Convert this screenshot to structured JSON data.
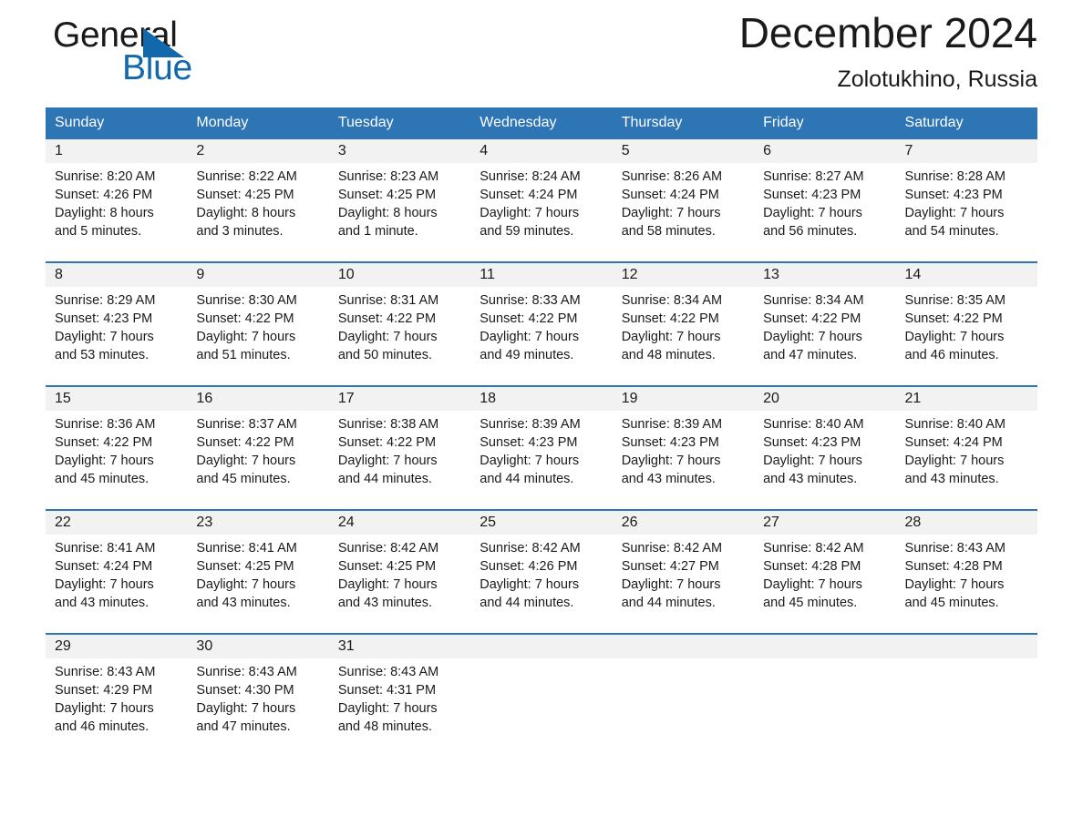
{
  "brand": {
    "word1": "General",
    "word2": "Blue",
    "triangle_color": "#1268ad"
  },
  "header": {
    "month_title": "December 2024",
    "location": "Zolotukhino, Russia",
    "accent_color": "#2e75b6",
    "daynum_band_color": "#f2f2f2"
  },
  "weekday_headers": [
    "Sunday",
    "Monday",
    "Tuesday",
    "Wednesday",
    "Thursday",
    "Friday",
    "Saturday"
  ],
  "labels": {
    "sunrise_prefix": "Sunrise:",
    "sunset_prefix": "Sunset:",
    "daylight_prefix": "Daylight:"
  },
  "weeks": [
    [
      {
        "day": "1",
        "sunrise": "Sunrise: 8:20 AM",
        "sunset": "Sunset: 4:26 PM",
        "daylight_line1": "Daylight: 8 hours",
        "daylight_line2": "and 5 minutes."
      },
      {
        "day": "2",
        "sunrise": "Sunrise: 8:22 AM",
        "sunset": "Sunset: 4:25 PM",
        "daylight_line1": "Daylight: 8 hours",
        "daylight_line2": "and 3 minutes."
      },
      {
        "day": "3",
        "sunrise": "Sunrise: 8:23 AM",
        "sunset": "Sunset: 4:25 PM",
        "daylight_line1": "Daylight: 8 hours",
        "daylight_line2": "and 1 minute."
      },
      {
        "day": "4",
        "sunrise": "Sunrise: 8:24 AM",
        "sunset": "Sunset: 4:24 PM",
        "daylight_line1": "Daylight: 7 hours",
        "daylight_line2": "and 59 minutes."
      },
      {
        "day": "5",
        "sunrise": "Sunrise: 8:26 AM",
        "sunset": "Sunset: 4:24 PM",
        "daylight_line1": "Daylight: 7 hours",
        "daylight_line2": "and 58 minutes."
      },
      {
        "day": "6",
        "sunrise": "Sunrise: 8:27 AM",
        "sunset": "Sunset: 4:23 PM",
        "daylight_line1": "Daylight: 7 hours",
        "daylight_line2": "and 56 minutes."
      },
      {
        "day": "7",
        "sunrise": "Sunrise: 8:28 AM",
        "sunset": "Sunset: 4:23 PM",
        "daylight_line1": "Daylight: 7 hours",
        "daylight_line2": "and 54 minutes."
      }
    ],
    [
      {
        "day": "8",
        "sunrise": "Sunrise: 8:29 AM",
        "sunset": "Sunset: 4:23 PM",
        "daylight_line1": "Daylight: 7 hours",
        "daylight_line2": "and 53 minutes."
      },
      {
        "day": "9",
        "sunrise": "Sunrise: 8:30 AM",
        "sunset": "Sunset: 4:22 PM",
        "daylight_line1": "Daylight: 7 hours",
        "daylight_line2": "and 51 minutes."
      },
      {
        "day": "10",
        "sunrise": "Sunrise: 8:31 AM",
        "sunset": "Sunset: 4:22 PM",
        "daylight_line1": "Daylight: 7 hours",
        "daylight_line2": "and 50 minutes."
      },
      {
        "day": "11",
        "sunrise": "Sunrise: 8:33 AM",
        "sunset": "Sunset: 4:22 PM",
        "daylight_line1": "Daylight: 7 hours",
        "daylight_line2": "and 49 minutes."
      },
      {
        "day": "12",
        "sunrise": "Sunrise: 8:34 AM",
        "sunset": "Sunset: 4:22 PM",
        "daylight_line1": "Daylight: 7 hours",
        "daylight_line2": "and 48 minutes."
      },
      {
        "day": "13",
        "sunrise": "Sunrise: 8:34 AM",
        "sunset": "Sunset: 4:22 PM",
        "daylight_line1": "Daylight: 7 hours",
        "daylight_line2": "and 47 minutes."
      },
      {
        "day": "14",
        "sunrise": "Sunrise: 8:35 AM",
        "sunset": "Sunset: 4:22 PM",
        "daylight_line1": "Daylight: 7 hours",
        "daylight_line2": "and 46 minutes."
      }
    ],
    [
      {
        "day": "15",
        "sunrise": "Sunrise: 8:36 AM",
        "sunset": "Sunset: 4:22 PM",
        "daylight_line1": "Daylight: 7 hours",
        "daylight_line2": "and 45 minutes."
      },
      {
        "day": "16",
        "sunrise": "Sunrise: 8:37 AM",
        "sunset": "Sunset: 4:22 PM",
        "daylight_line1": "Daylight: 7 hours",
        "daylight_line2": "and 45 minutes."
      },
      {
        "day": "17",
        "sunrise": "Sunrise: 8:38 AM",
        "sunset": "Sunset: 4:22 PM",
        "daylight_line1": "Daylight: 7 hours",
        "daylight_line2": "and 44 minutes."
      },
      {
        "day": "18",
        "sunrise": "Sunrise: 8:39 AM",
        "sunset": "Sunset: 4:23 PM",
        "daylight_line1": "Daylight: 7 hours",
        "daylight_line2": "and 44 minutes."
      },
      {
        "day": "19",
        "sunrise": "Sunrise: 8:39 AM",
        "sunset": "Sunset: 4:23 PM",
        "daylight_line1": "Daylight: 7 hours",
        "daylight_line2": "and 43 minutes."
      },
      {
        "day": "20",
        "sunrise": "Sunrise: 8:40 AM",
        "sunset": "Sunset: 4:23 PM",
        "daylight_line1": "Daylight: 7 hours",
        "daylight_line2": "and 43 minutes."
      },
      {
        "day": "21",
        "sunrise": "Sunrise: 8:40 AM",
        "sunset": "Sunset: 4:24 PM",
        "daylight_line1": "Daylight: 7 hours",
        "daylight_line2": "and 43 minutes."
      }
    ],
    [
      {
        "day": "22",
        "sunrise": "Sunrise: 8:41 AM",
        "sunset": "Sunset: 4:24 PM",
        "daylight_line1": "Daylight: 7 hours",
        "daylight_line2": "and 43 minutes."
      },
      {
        "day": "23",
        "sunrise": "Sunrise: 8:41 AM",
        "sunset": "Sunset: 4:25 PM",
        "daylight_line1": "Daylight: 7 hours",
        "daylight_line2": "and 43 minutes."
      },
      {
        "day": "24",
        "sunrise": "Sunrise: 8:42 AM",
        "sunset": "Sunset: 4:25 PM",
        "daylight_line1": "Daylight: 7 hours",
        "daylight_line2": "and 43 minutes."
      },
      {
        "day": "25",
        "sunrise": "Sunrise: 8:42 AM",
        "sunset": "Sunset: 4:26 PM",
        "daylight_line1": "Daylight: 7 hours",
        "daylight_line2": "and 44 minutes."
      },
      {
        "day": "26",
        "sunrise": "Sunrise: 8:42 AM",
        "sunset": "Sunset: 4:27 PM",
        "daylight_line1": "Daylight: 7 hours",
        "daylight_line2": "and 44 minutes."
      },
      {
        "day": "27",
        "sunrise": "Sunrise: 8:42 AM",
        "sunset": "Sunset: 4:28 PM",
        "daylight_line1": "Daylight: 7 hours",
        "daylight_line2": "and 45 minutes."
      },
      {
        "day": "28",
        "sunrise": "Sunrise: 8:43 AM",
        "sunset": "Sunset: 4:28 PM",
        "daylight_line1": "Daylight: 7 hours",
        "daylight_line2": "and 45 minutes."
      }
    ],
    [
      {
        "day": "29",
        "sunrise": "Sunrise: 8:43 AM",
        "sunset": "Sunset: 4:29 PM",
        "daylight_line1": "Daylight: 7 hours",
        "daylight_line2": "and 46 minutes."
      },
      {
        "day": "30",
        "sunrise": "Sunrise: 8:43 AM",
        "sunset": "Sunset: 4:30 PM",
        "daylight_line1": "Daylight: 7 hours",
        "daylight_line2": "and 47 minutes."
      },
      {
        "day": "31",
        "sunrise": "Sunrise: 8:43 AM",
        "sunset": "Sunset: 4:31 PM",
        "daylight_line1": "Daylight: 7 hours",
        "daylight_line2": "and 48 minutes."
      },
      {
        "day": "",
        "sunrise": "",
        "sunset": "",
        "daylight_line1": "",
        "daylight_line2": ""
      },
      {
        "day": "",
        "sunrise": "",
        "sunset": "",
        "daylight_line1": "",
        "daylight_line2": ""
      },
      {
        "day": "",
        "sunrise": "",
        "sunset": "",
        "daylight_line1": "",
        "daylight_line2": ""
      },
      {
        "day": "",
        "sunrise": "",
        "sunset": "",
        "daylight_line1": "",
        "daylight_line2": ""
      }
    ]
  ]
}
